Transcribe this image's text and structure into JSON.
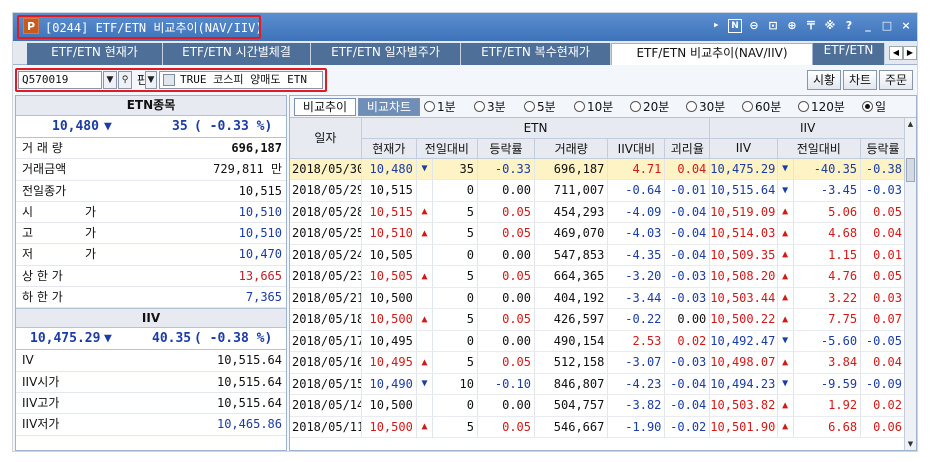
{
  "window": {
    "icon_letter": "P",
    "title": "[0244] ETF/ETN 비교추이(NAV/IIV)",
    "toolbar_icons": [
      "‣",
      "N",
      "⊖",
      "⊡",
      "⊕",
      "〒",
      "※",
      "?",
      "_",
      "□",
      "×"
    ]
  },
  "tabs": [
    {
      "label": "ETF/ETN 현재가",
      "active": false
    },
    {
      "label": "ETF/ETN 시간별체결",
      "active": false
    },
    {
      "label": "ETF/ETN 일자별주가",
      "active": false
    },
    {
      "label": "ETF/ETN 복수현재가",
      "active": false
    },
    {
      "label": "ETF/ETN 비교추이(NAV/IIV)",
      "active": true
    },
    {
      "label": "ETF/ETN",
      "active": false
    }
  ],
  "toolbar": {
    "code": "Q570019",
    "pan_label": "판",
    "name": "TRUE 코스피 양매도 ETN",
    "buttons": [
      "시황",
      "차트",
      "주문"
    ]
  },
  "left": {
    "header": "ETN종목",
    "price": "10,480",
    "price_arrow": "▼",
    "change": "35",
    "change_pct": "( -0.33 %)",
    "rows": [
      {
        "label": "거 래 량",
        "value": "696,187",
        "color": "#111111",
        "bold": true
      },
      {
        "label": "거래금액",
        "value": "729,811 만",
        "color": "#111111"
      },
      {
        "label": "전일종가",
        "value": "10,515",
        "color": "#111111"
      },
      {
        "label": "시 가",
        "value": "10,510",
        "color": "#1a3ba8",
        "spread": true
      },
      {
        "label": "고 가",
        "value": "10,510",
        "color": "#1a3ba8",
        "spread": true
      },
      {
        "label": "저 가",
        "value": "10,470",
        "color": "#1a3ba8",
        "spread": true
      },
      {
        "label": "상 한 가",
        "value": "13,665",
        "color": "#c41e2a"
      },
      {
        "label": "하 한 가",
        "value": "7,365",
        "color": "#1a3ba8"
      }
    ],
    "iiv_header": "IIV",
    "iiv_price": "10,475.29",
    "iiv_arrow": "▼",
    "iiv_change": "40.35",
    "iiv_change_pct": "( -0.38 %)",
    "iiv_rows": [
      {
        "label": "IV",
        "value": "10,515.64",
        "color": "#111111"
      },
      {
        "label": "IIV시가",
        "value": "10,515.64",
        "color": "#111111"
      },
      {
        "label": "IIV고가",
        "value": "10,515.64",
        "color": "#111111"
      },
      {
        "label": "IIV저가",
        "value": "10,465.86",
        "color": "#1a3ba8"
      }
    ]
  },
  "grid": {
    "buttons": [
      "비교추이",
      "비교차트"
    ],
    "radios": [
      "1분",
      "3분",
      "5분",
      "10분",
      "20분",
      "30분",
      "60분",
      "120분",
      "일"
    ],
    "selected_radio": "일",
    "group_etn": "ETN",
    "group_iiv": "IIV",
    "columns": [
      "일자",
      "현재가",
      "전일대비",
      "등락률",
      "거래량",
      "IIV대비",
      "괴리율",
      "IIV",
      "전일대비",
      "등락률"
    ],
    "rows": [
      {
        "date": "2018/05/30",
        "price": "10,480",
        "dir": "dn",
        "chg": "35",
        "pct": "-0.33",
        "vol": "696,187",
        "iivd": "4.71",
        "gap": "0.04",
        "iiv": "10,475.29",
        "idir": "dn",
        "ichg": "-40.35",
        "ipct": "-0.38",
        "sel": true
      },
      {
        "date": "2018/05/29",
        "price": "10,515",
        "dir": "",
        "chg": "0",
        "pct": "0.00",
        "vol": "711,007",
        "iivd": "-0.64",
        "gap": "-0.01",
        "iiv": "10,515.64",
        "idir": "dn",
        "ichg": "-3.45",
        "ipct": "-0.03"
      },
      {
        "date": "2018/05/28",
        "price": "10,515",
        "dir": "up",
        "chg": "5",
        "pct": "0.05",
        "vol": "454,293",
        "iivd": "-4.09",
        "gap": "-0.04",
        "iiv": "10,519.09",
        "idir": "up",
        "ichg": "5.06",
        "ipct": "0.05"
      },
      {
        "date": "2018/05/25",
        "price": "10,510",
        "dir": "up",
        "chg": "5",
        "pct": "0.05",
        "vol": "469,070",
        "iivd": "-4.03",
        "gap": "-0.04",
        "iiv": "10,514.03",
        "idir": "up",
        "ichg": "4.68",
        "ipct": "0.04"
      },
      {
        "date": "2018/05/24",
        "price": "10,505",
        "dir": "",
        "chg": "0",
        "pct": "0.00",
        "vol": "547,853",
        "iivd": "-4.35",
        "gap": "-0.04",
        "iiv": "10,509.35",
        "idir": "up",
        "ichg": "1.15",
        "ipct": "0.01"
      },
      {
        "date": "2018/05/23",
        "price": "10,505",
        "dir": "up",
        "chg": "5",
        "pct": "0.05",
        "vol": "664,365",
        "iivd": "-3.20",
        "gap": "-0.03",
        "iiv": "10,508.20",
        "idir": "up",
        "ichg": "4.76",
        "ipct": "0.05"
      },
      {
        "date": "2018/05/21",
        "price": "10,500",
        "dir": "",
        "chg": "0",
        "pct": "0.00",
        "vol": "404,192",
        "iivd": "-3.44",
        "gap": "-0.03",
        "iiv": "10,503.44",
        "idir": "up",
        "ichg": "3.22",
        "ipct": "0.03"
      },
      {
        "date": "2018/05/18",
        "price": "10,500",
        "dir": "up",
        "chg": "5",
        "pct": "0.05",
        "vol": "426,597",
        "iivd": "-0.22",
        "gap": "0.00",
        "iiv": "10,500.22",
        "idir": "up",
        "ichg": "7.75",
        "ipct": "0.07"
      },
      {
        "date": "2018/05/17",
        "price": "10,495",
        "dir": "",
        "chg": "0",
        "pct": "0.00",
        "vol": "490,154",
        "iivd": "2.53",
        "gap": "0.02",
        "iiv": "10,492.47",
        "idir": "dn",
        "ichg": "-5.60",
        "ipct": "-0.05"
      },
      {
        "date": "2018/05/16",
        "price": "10,495",
        "dir": "up",
        "chg": "5",
        "pct": "0.05",
        "vol": "512,158",
        "iivd": "-3.07",
        "gap": "-0.03",
        "iiv": "10,498.07",
        "idir": "up",
        "ichg": "3.84",
        "ipct": "0.04"
      },
      {
        "date": "2018/05/15",
        "price": "10,490",
        "dir": "dn",
        "chg": "10",
        "pct": "-0.10",
        "vol": "846,807",
        "iivd": "-4.23",
        "gap": "-0.04",
        "iiv": "10,494.23",
        "idir": "dn",
        "ichg": "-9.59",
        "ipct": "-0.09"
      },
      {
        "date": "2018/05/14",
        "price": "10,500",
        "dir": "",
        "chg": "0",
        "pct": "0.00",
        "vol": "504,757",
        "iivd": "-3.82",
        "gap": "-0.04",
        "iiv": "10,503.82",
        "idir": "up",
        "ichg": "1.92",
        "ipct": "0.02"
      },
      {
        "date": "2018/05/11",
        "price": "10,500",
        "dir": "up",
        "chg": "5",
        "pct": "0.05",
        "vol": "546,667",
        "iivd": "-1.90",
        "gap": "-0.02",
        "iiv": "10,501.90",
        "idir": "up",
        "ichg": "6.68",
        "ipct": "0.06"
      }
    ]
  },
  "colors": {
    "up": "#d41818",
    "down": "#1a3ba8",
    "highlight": "#e21b22",
    "selected_row": "#fdf3c4"
  }
}
